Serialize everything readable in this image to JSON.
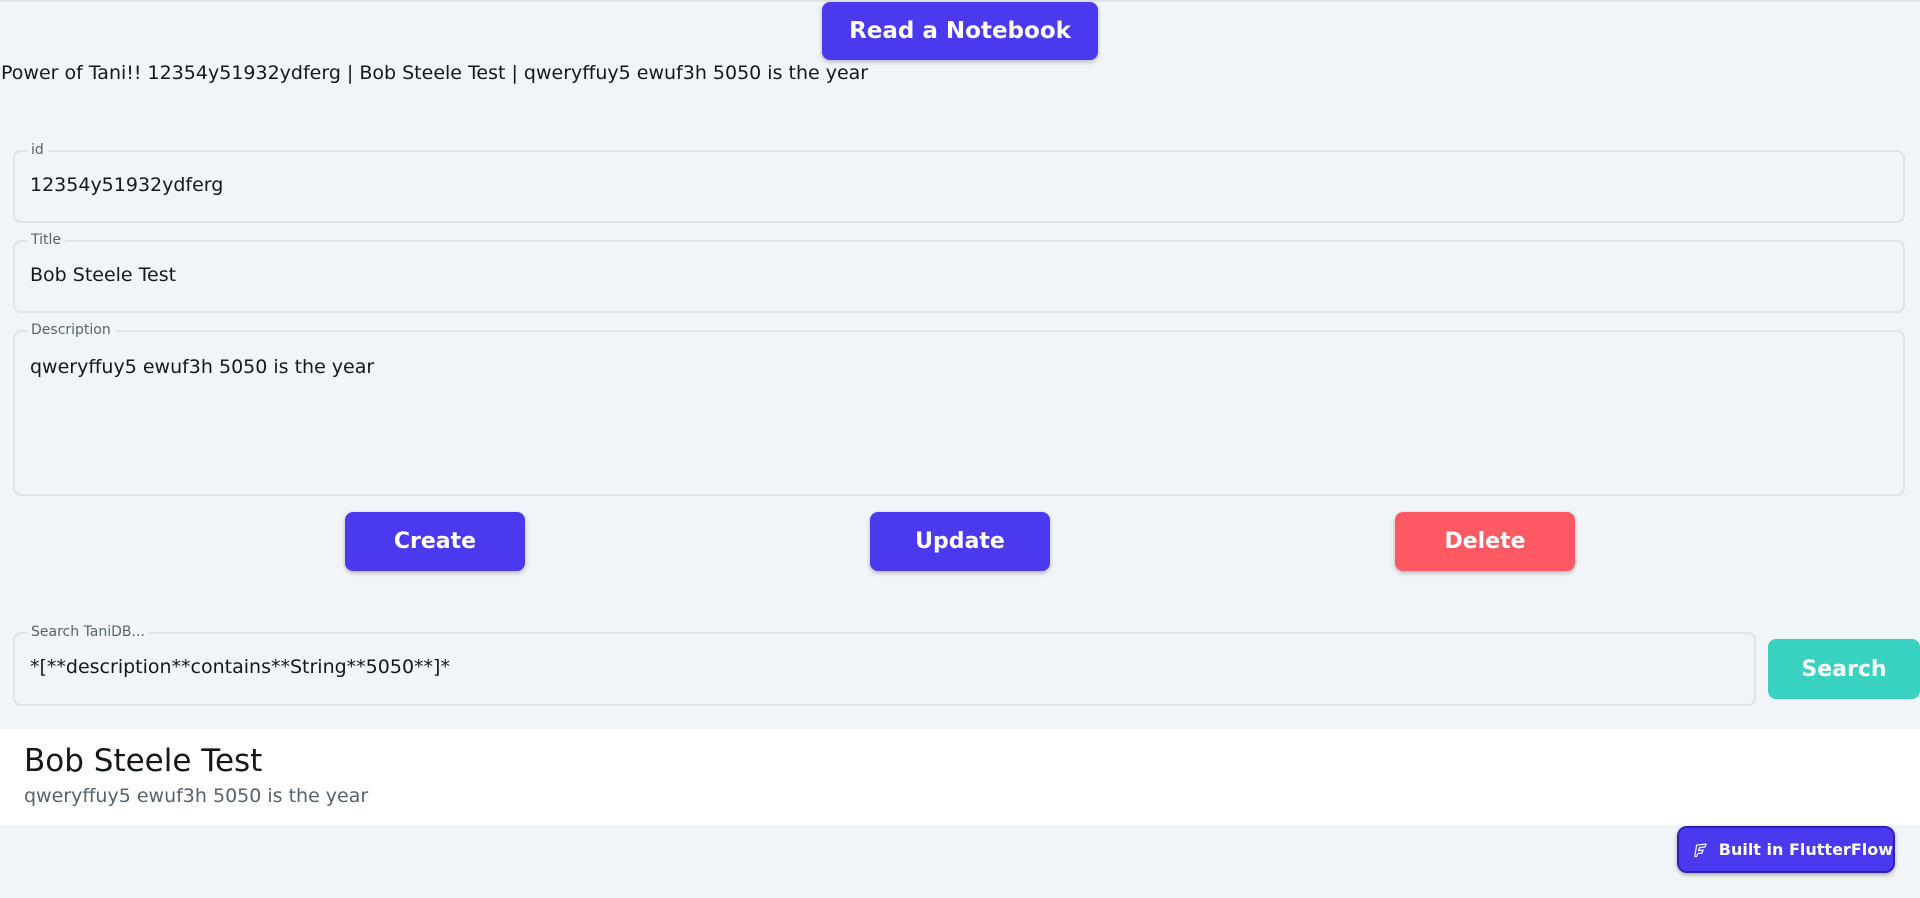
{
  "header": {
    "read_button_label": "Read a Notebook",
    "summary": "Power of Tani!! 12354y51932ydferg | Bob Steele Test | qweryffuy5 ewuf3h 5050 is the year"
  },
  "form": {
    "id": {
      "label": "id",
      "value": "12354y51932ydferg"
    },
    "title": {
      "label": "Title",
      "value": "Bob Steele Test"
    },
    "description": {
      "label": "Description",
      "value": "qweryffuy5 ewuf3h 5050 is the year"
    }
  },
  "actions": {
    "create_label": "Create",
    "update_label": "Update",
    "delete_label": "Delete"
  },
  "search": {
    "label": "Search TaniDB...",
    "value": "*[**description**contains**String**5050**]*",
    "button_label": "Search"
  },
  "results": [
    {
      "title": "Bob Steele Test",
      "description": "qweryffuy5 ewuf3h 5050 is the year"
    }
  ],
  "badge": {
    "label": "Built in FlutterFlow",
    "icon": "flutterflow-logo-icon"
  },
  "colors": {
    "primary": "#4b39ef",
    "danger": "#ff5963",
    "teal": "#39d2c0",
    "background": "#f1f4f8",
    "card": "#ffffff"
  }
}
